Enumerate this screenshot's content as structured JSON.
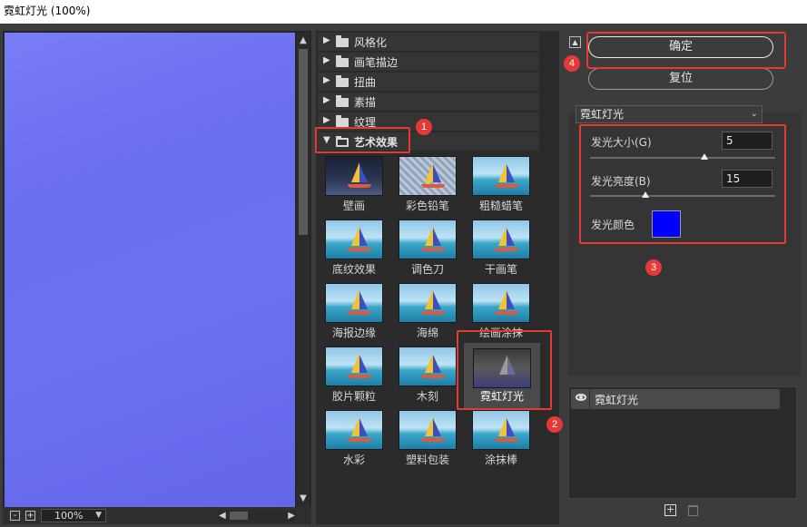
{
  "window": {
    "title": "霓虹灯光 (100%)"
  },
  "preview": {
    "zoom_label": "100%",
    "zoom_out": "-",
    "zoom_in": "+"
  },
  "gallery": {
    "categories": [
      {
        "label": "风格化"
      },
      {
        "label": "画笔描边"
      },
      {
        "label": "扭曲"
      },
      {
        "label": "素描"
      },
      {
        "label": "纹理"
      },
      {
        "label": "艺术效果"
      }
    ],
    "filters": [
      "壁画",
      "彩色铅笔",
      "粗糙蜡笔",
      "底纹效果",
      "调色刀",
      "干画笔",
      "海报边缘",
      "海绵",
      "绘画涂抹",
      "胶片颗粒",
      "木刻",
      "霓虹灯光",
      "水彩",
      "塑料包装",
      "涂抹棒"
    ],
    "selected_filter": "霓虹灯光"
  },
  "actions": {
    "ok": "确定",
    "reset": "复位"
  },
  "settings": {
    "filter_select": "霓虹灯光",
    "glow_size_label": "发光大小(G)",
    "glow_size_value": "5",
    "glow_size_level": 0.62,
    "glow_brightness_label": "发光亮度(B)",
    "glow_brightness_value": "15",
    "glow_brightness_level": 0.3,
    "glow_color_label": "发光颜色",
    "glow_color": "#0000ff"
  },
  "layers": {
    "items": [
      {
        "label": "霓虹灯光",
        "visible": true
      }
    ]
  },
  "annotations": [
    "1",
    "2",
    "3",
    "4"
  ],
  "colors": {
    "annotation": "#e53935",
    "preview": "#6b70f2"
  }
}
